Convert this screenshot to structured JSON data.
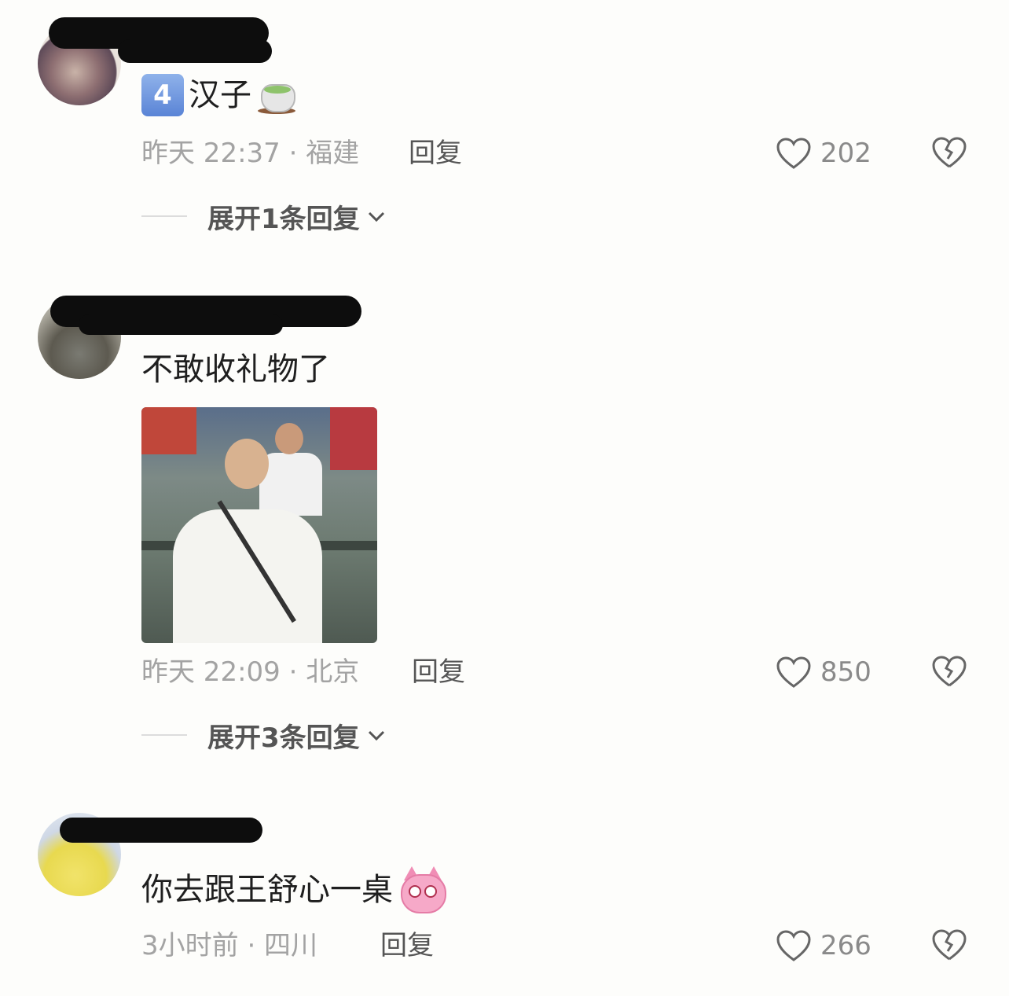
{
  "comments": [
    {
      "username": "",
      "text": "汉子",
      "badge": "4",
      "emoji": "teacup-emoji",
      "time_location": "昨天 22:37 · 福建",
      "reply_label": "回复",
      "likes": "202",
      "expand_label": "展开1条回复"
    },
    {
      "username": "",
      "text": "不敢收礼物了",
      "has_image": true,
      "time_location": "昨天 22:09 · 北京",
      "reply_label": "回复",
      "likes": "850",
      "expand_label": "展开3条回复"
    },
    {
      "username": "",
      "text": "你去跟王舒心一桌",
      "emoji": "pink-cat-emoji",
      "time_location": "3小时前 · 四川",
      "reply_label": "回复",
      "likes": "266"
    }
  ],
  "colors": {
    "background": "#fdfdfb",
    "meta_text": "#a3a3a3",
    "icon_stroke": "#555555"
  }
}
